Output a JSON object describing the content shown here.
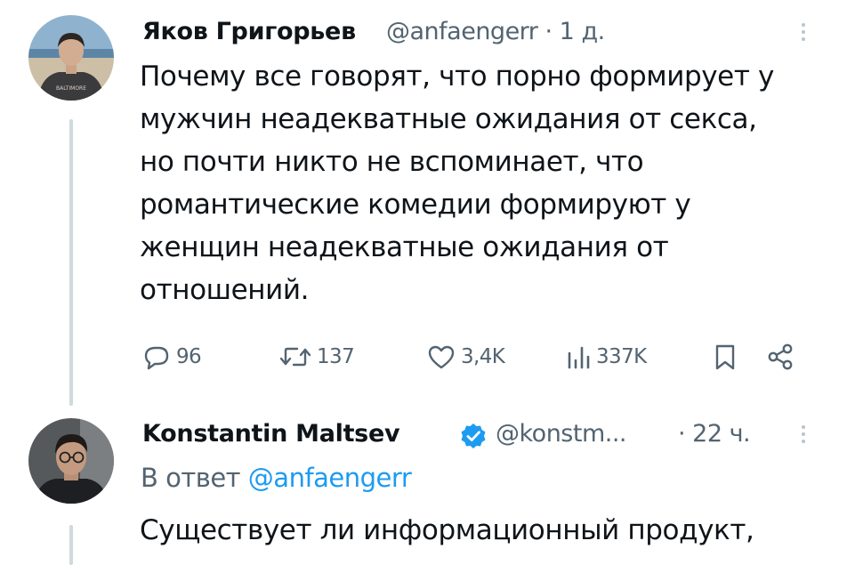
{
  "tweet1": {
    "author_name": "Яков Григорьев",
    "handle": "@anfaengerr",
    "time": "· 1 д.",
    "text_lines": [
      "Почему все говорят, что порно формирует у",
      "мужчин неадекватные ожидания от секса,",
      "но почти никто не вспоминает, что",
      "романтические комедии формируют у",
      "женщин неадекватные ожидания от",
      "отношений."
    ],
    "actions": {
      "replies": "96",
      "retweets": "137",
      "likes": "3,4K",
      "views": "337K"
    }
  },
  "tweet2": {
    "author_name": "Konstantin Maltsev",
    "handle": "@konstm...",
    "time": "· 22 ч.",
    "reply_prefix": "В ответ",
    "reply_to": "@anfaengerr",
    "text_lines": [
      "Существует ли информационный продукт,"
    ]
  },
  "colors": {
    "text": "#0f1419",
    "secondary": "#536471",
    "accent": "#1d9bf0",
    "thread_line": "#cfd9de"
  },
  "icons": [
    "reply-icon",
    "retweet-icon",
    "like-icon",
    "views-icon",
    "bookmark-icon",
    "share-icon",
    "verified-badge-icon",
    "more-icon"
  ]
}
